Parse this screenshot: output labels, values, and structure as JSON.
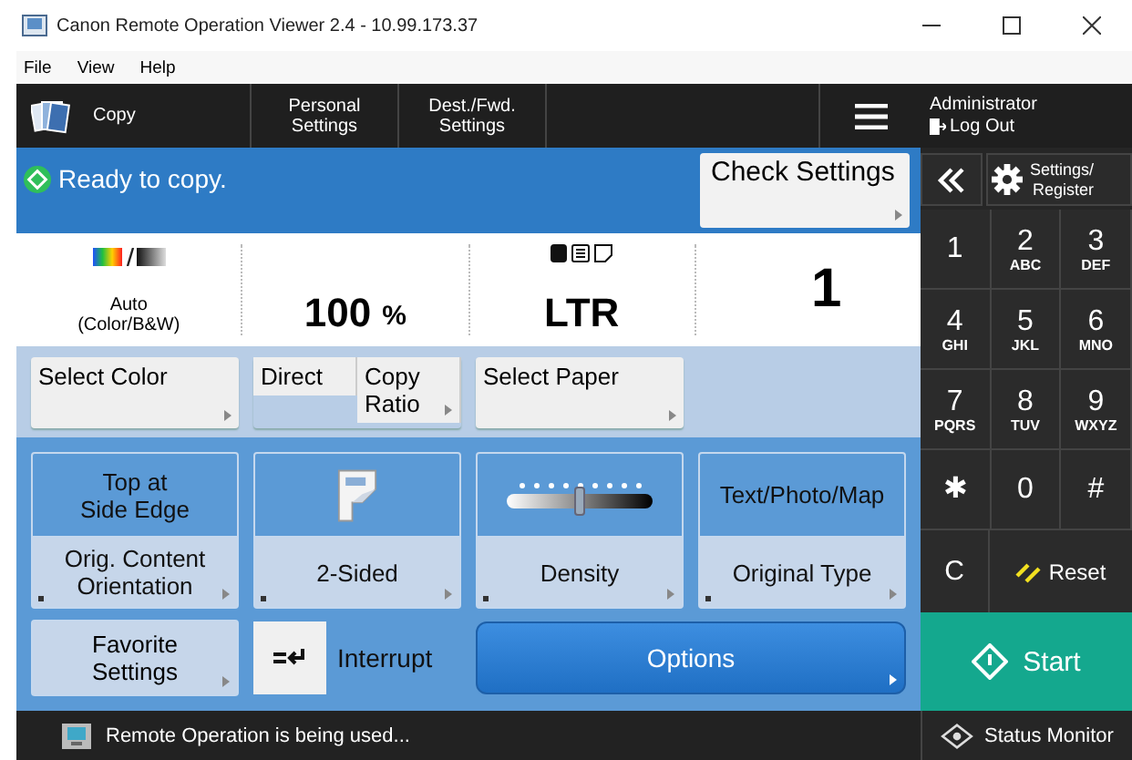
{
  "window": {
    "title": "Canon Remote Operation Viewer 2.4 - 10.99.173.37"
  },
  "menu": [
    "File",
    "View",
    "Help"
  ],
  "top_tabs": [
    {
      "label": [
        "Copy"
      ],
      "kind": "copy"
    },
    {
      "label": [
        "Personal",
        "Settings"
      ],
      "kind": "plain"
    },
    {
      "label": [
        "Dest./Fwd.",
        "Settings"
      ],
      "kind": "plain"
    }
  ],
  "user": {
    "name": "Administrator",
    "logout": "Log Out"
  },
  "status": {
    "message": "Ready to copy.",
    "check_settings": "Check Settings"
  },
  "summary": {
    "color_mode": [
      "Auto",
      "(Color/B&W)"
    ],
    "ratio": "100",
    "ratio_unit": "%",
    "paper": "LTR",
    "copies": "1"
  },
  "setting_buttons": [
    {
      "label": [
        "Select Color"
      ]
    },
    {
      "label": [
        "Direct"
      ],
      "label2": [
        "Copy",
        "Ratio"
      ]
    },
    {
      "label": [
        "Select Paper"
      ]
    }
  ],
  "function_tiles": [
    {
      "kind": "text",
      "value": [
        "Top at",
        "Side Edge"
      ],
      "label": [
        "Orig. Content",
        "Orientation"
      ]
    },
    {
      "kind": "duplex",
      "label": [
        "2-Sided"
      ]
    },
    {
      "kind": "density",
      "level": 0.5,
      "label": [
        "Density"
      ]
    },
    {
      "kind": "text",
      "value": [
        "Text/Photo/Map"
      ],
      "label": [
        "Original Type"
      ]
    }
  ],
  "favorite": [
    "Favorite",
    "Settings"
  ],
  "interrupt": "Interrupt",
  "options": "Options",
  "settings_register": [
    "Settings/",
    "Register"
  ],
  "keypad": [
    {
      "digit": "1"
    },
    {
      "digit": "2",
      "letters": "ABC"
    },
    {
      "digit": "3",
      "letters": "DEF"
    },
    {
      "digit": "4",
      "letters": "GHI"
    },
    {
      "digit": "5",
      "letters": "JKL"
    },
    {
      "digit": "6",
      "letters": "MNO"
    },
    {
      "digit": "7",
      "letters": "PQRS"
    },
    {
      "digit": "8",
      "letters": "TUV"
    },
    {
      "digit": "9",
      "letters": "WXYZ"
    },
    {
      "digit": "✱"
    },
    {
      "digit": "0"
    },
    {
      "digit": "#"
    }
  ],
  "clear": "C",
  "reset": "Reset",
  "start": "Start",
  "status_bar": {
    "message": "Remote Operation is being used...",
    "monitor": "Status Monitor"
  }
}
